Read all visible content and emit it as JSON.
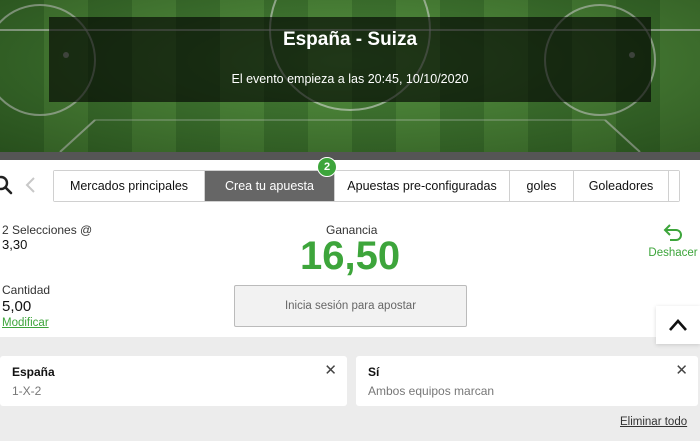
{
  "event": {
    "title": "España - Suiza",
    "start_text": "El evento empieza a las 20:45, 10/10/2020"
  },
  "tabs": [
    {
      "label": "Mercados principales",
      "active": false
    },
    {
      "label": "Crea tu apuesta",
      "active": true,
      "badge": "2"
    },
    {
      "label": "Apuestas pre-configuradas",
      "active": false
    },
    {
      "label": "goles",
      "active": false
    },
    {
      "label": "Goleadores",
      "active": false
    }
  ],
  "icons": {
    "search": "search-icon",
    "prev": "chevron-left-icon",
    "undo": "undo-arrow-icon",
    "scroll_top": "chevron-up-icon",
    "close": "close-icon"
  },
  "betslip": {
    "selections_label": "2 Selecciones @",
    "odds": "3,30",
    "gain_label": "Ganancia",
    "gain_value": "16,50",
    "undo_label": "Deshacer",
    "quantity_label": "Cantidad",
    "quantity_value": "5,00",
    "modify_label": "Modificar",
    "login_label": "Inicia sesión para apostar"
  },
  "selections": [
    {
      "team": "España",
      "market": "1-X-2"
    },
    {
      "team": "Sí",
      "market": "Ambos equipos marcan"
    }
  ],
  "clear_all_label": "Eliminar todo",
  "colors": {
    "accent": "#3da53b",
    "active_tab": "#666666",
    "pitch_dark": "#3d7a2c",
    "pitch_light": "#4c8d36"
  }
}
